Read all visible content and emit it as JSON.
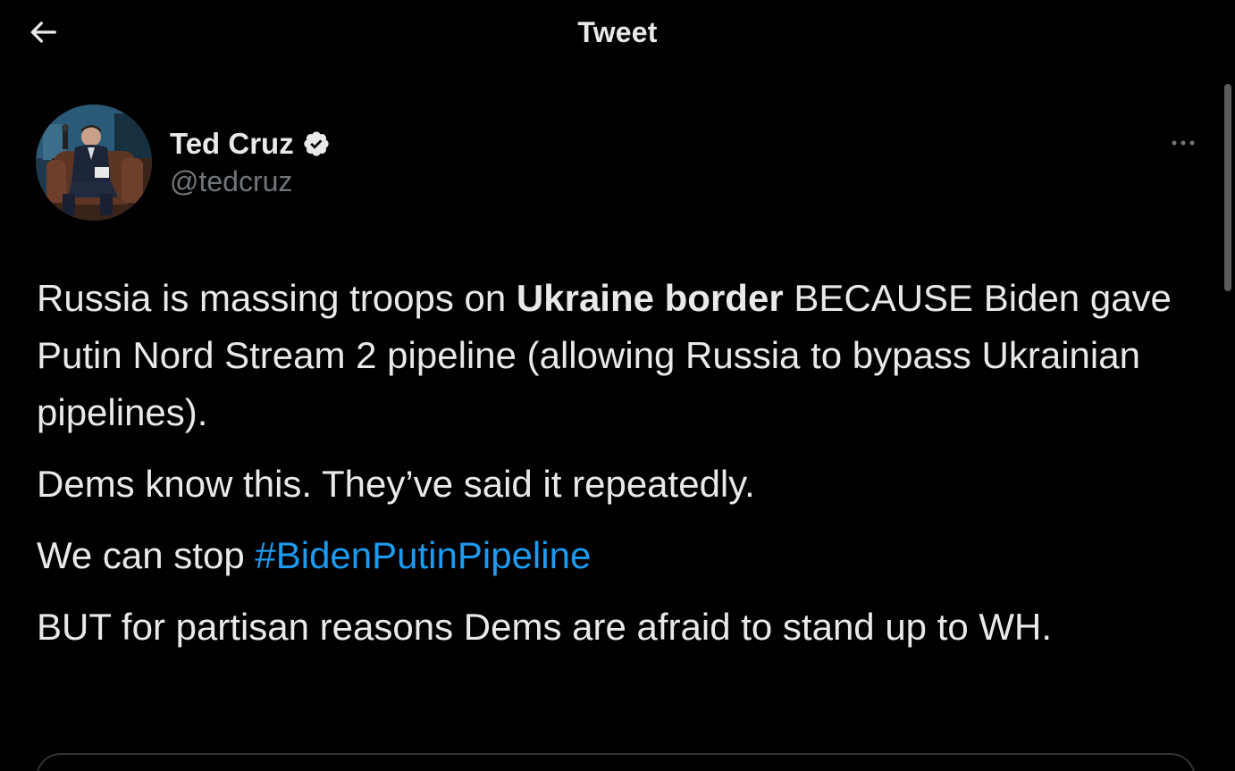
{
  "header": {
    "title": "Tweet",
    "back_icon": "arrow-left-icon"
  },
  "author": {
    "name": "Ted Cruz",
    "handle": "@tedcruz",
    "verified_icon": "verified-badge-icon",
    "verified_color": "#e7e9ea"
  },
  "more_icon": "more-horizontal-icon",
  "tweet": {
    "p1_pre": "Russia is massing troops on ",
    "p1_bold": "Ukraine border",
    "p1_post": " BECAUSE Biden gave Putin Nord Stream 2 pipeline (allowing Russia to bypass Ukrainian pipelines).",
    "p2": "Dems know this. They’ve said it repeatedly.",
    "p3_pre": "We can stop ",
    "p3_hashtag": "#BidenPutinPipeline",
    "p4": "BUT for partisan reasons Dems are afraid to stand up to WH."
  },
  "colors": {
    "background": "#000000",
    "text": "#e7e9ea",
    "secondary": "#71767b",
    "link": "#1d9bf0",
    "border": "#2f3336"
  }
}
